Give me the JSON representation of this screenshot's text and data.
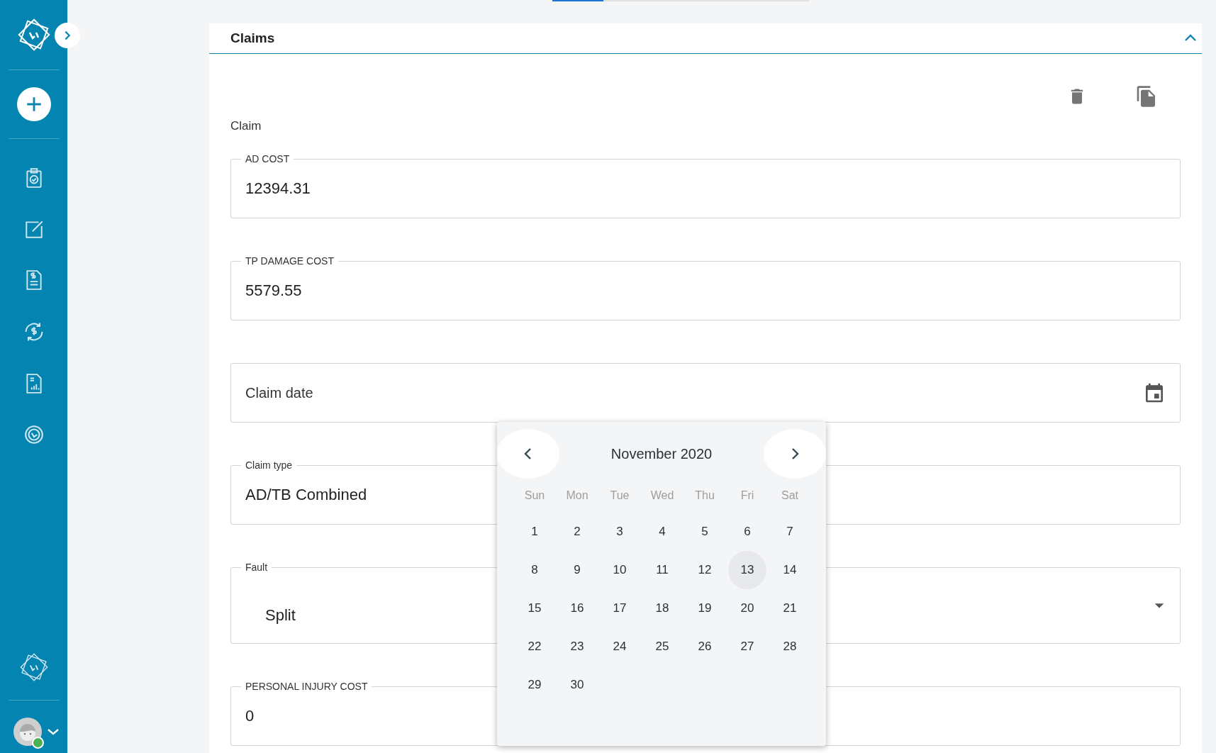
{
  "section": {
    "title": "Claims",
    "expanded": true
  },
  "subtitle": "Claim",
  "fields": [
    {
      "kind": "text",
      "label": "AD COST",
      "value": "12394.31"
    },
    {
      "kind": "text",
      "label": "TP DAMAGE COST",
      "value": "5579.55"
    },
    {
      "kind": "date",
      "placeholder": "Claim date"
    },
    {
      "kind": "text",
      "label": "Claim type",
      "value": "AD/TB Combined"
    },
    {
      "kind": "select",
      "label": "Fault",
      "value": "Split"
    },
    {
      "kind": "text",
      "label": "PERSONAL INJURY COST",
      "value": "0"
    }
  ],
  "calendar": {
    "month": "November 2020",
    "weekdays": [
      "Sun",
      "Mon",
      "Tue",
      "Wed",
      "Thu",
      "Fri",
      "Sat"
    ],
    "days": [
      {
        "label": "1",
        "selected": false
      },
      {
        "label": "2",
        "selected": false
      },
      {
        "label": "3",
        "selected": false
      },
      {
        "label": "4",
        "selected": false
      },
      {
        "label": "5",
        "selected": false
      },
      {
        "label": "6",
        "selected": false
      },
      {
        "label": "7",
        "selected": false
      },
      {
        "label": "8",
        "selected": false
      },
      {
        "label": "9",
        "selected": false
      },
      {
        "label": "10",
        "selected": false
      },
      {
        "label": "11",
        "selected": false
      },
      {
        "label": "12",
        "selected": false
      },
      {
        "label": "13",
        "selected": true
      },
      {
        "label": "14",
        "selected": false
      },
      {
        "label": "15",
        "selected": false
      },
      {
        "label": "16",
        "selected": false
      },
      {
        "label": "17",
        "selected": false
      },
      {
        "label": "18",
        "selected": false
      },
      {
        "label": "19",
        "selected": false
      },
      {
        "label": "20",
        "selected": false
      },
      {
        "label": "21",
        "selected": false
      },
      {
        "label": "22",
        "selected": false
      },
      {
        "label": "23",
        "selected": false
      },
      {
        "label": "24",
        "selected": false
      },
      {
        "label": "25",
        "selected": false
      },
      {
        "label": "26",
        "selected": false
      },
      {
        "label": "27",
        "selected": false
      },
      {
        "label": "28",
        "selected": false
      },
      {
        "label": "29",
        "selected": false
      },
      {
        "label": "30",
        "selected": false
      }
    ]
  },
  "user": {
    "online": true
  }
}
